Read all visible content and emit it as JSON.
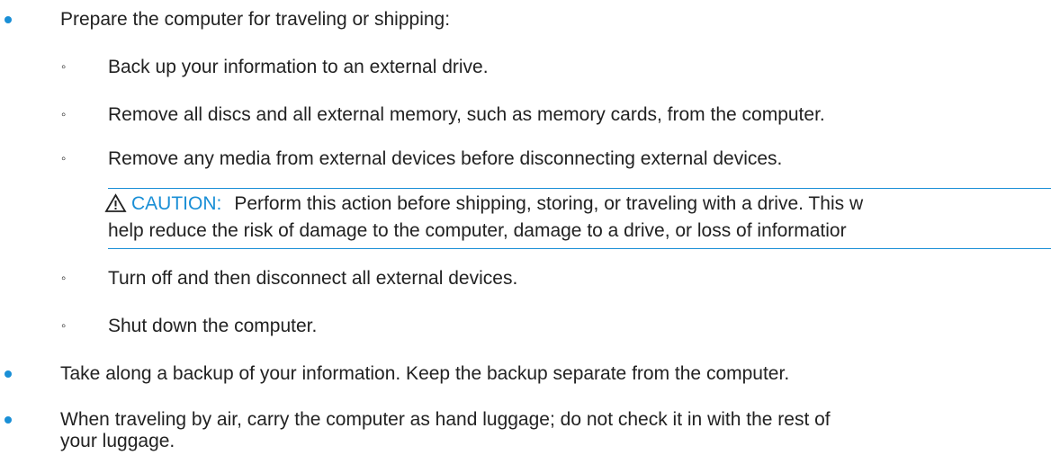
{
  "colors": {
    "bullet": "#1a8fd6",
    "caution_label": "#1a8fd6",
    "caution_rule": "#1a8fd6",
    "text": "#222222"
  },
  "list": {
    "item1": {
      "bullet_icon": "filled-circle-bullet-icon",
      "text": "Prepare the computer for traveling or shipping:",
      "subitems": [
        {
          "marker": "◦",
          "text": "Back up your information to an external drive."
        },
        {
          "marker": "◦",
          "text": "Remove all discs and all external memory, such as memory cards, from the computer."
        },
        {
          "marker": "◦",
          "text": "Remove any media from external devices before disconnecting external devices."
        }
      ],
      "caution": {
        "icon": "warning-triangle-icon",
        "label": "CAUTION:",
        "line1": "Perform this action before shipping, storing, or traveling with a drive. This w",
        "line2": "help reduce the risk of damage to the computer, damage to a drive, or loss of informatior"
      },
      "subitems_after": [
        {
          "marker": "◦",
          "text": "Turn off and then disconnect all external devices."
        },
        {
          "marker": "◦",
          "text": "Shut down the computer."
        }
      ]
    },
    "item2": {
      "bullet_icon": "filled-circle-bullet-icon",
      "text": "Take along a backup of your information. Keep the backup separate from the computer."
    },
    "item3": {
      "bullet_icon": "filled-circle-bullet-icon",
      "line1": "When traveling by air, carry the computer as hand luggage; do not check it in with the rest of",
      "line2": "your luggage."
    }
  }
}
